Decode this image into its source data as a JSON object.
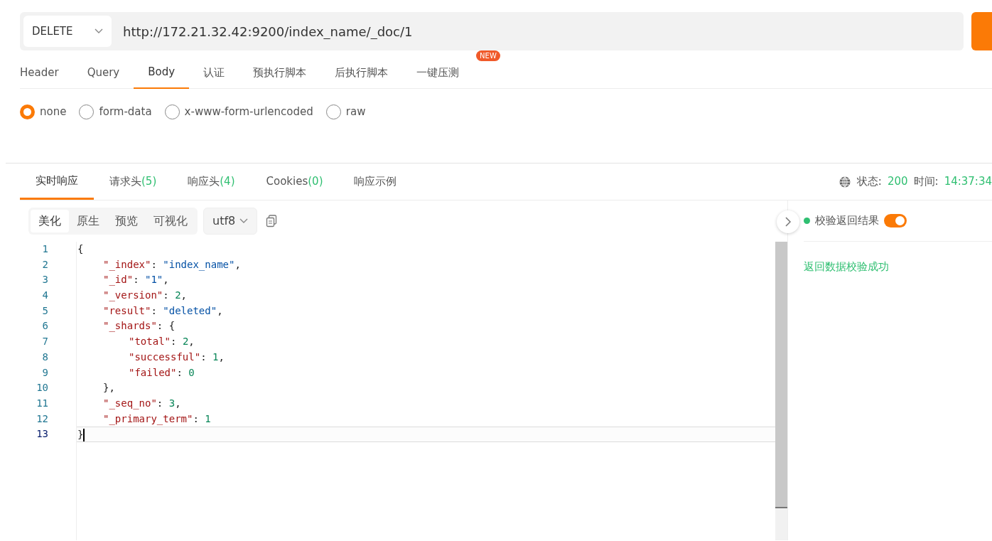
{
  "request": {
    "method": "DELETE",
    "url": "http://172.21.32.42:9200/index_name/_doc/1"
  },
  "request_tabs": [
    {
      "label": "Header",
      "selected": false
    },
    {
      "label": "Query",
      "selected": false
    },
    {
      "label": "Body",
      "selected": true
    },
    {
      "label": "认证",
      "selected": false
    },
    {
      "label": "预执行脚本",
      "selected": false
    },
    {
      "label": "后执行脚本",
      "selected": false
    },
    {
      "label": "一键压测",
      "selected": false,
      "badge": "NEW"
    }
  ],
  "body_types": [
    {
      "label": "none",
      "selected": true
    },
    {
      "label": "form-data",
      "selected": false
    },
    {
      "label": "x-www-form-urlencoded",
      "selected": false
    },
    {
      "label": "raw",
      "selected": false
    }
  ],
  "response_tabs": [
    {
      "label": "实时响应",
      "selected": true
    },
    {
      "label": "请求头",
      "count": "(5)",
      "selected": false
    },
    {
      "label": "响应头",
      "count": "(4)",
      "selected": false
    },
    {
      "label": "Cookies",
      "count": "(0)",
      "selected": false
    },
    {
      "label": "响应示例",
      "selected": false
    }
  ],
  "status": {
    "status_label": "状态:",
    "status_value": "200",
    "time_label": "时间:",
    "time_value": "14:37:34"
  },
  "view_modes": [
    {
      "label": "美化",
      "selected": true
    },
    {
      "label": "原生",
      "selected": false
    },
    {
      "label": "预览",
      "selected": false
    },
    {
      "label": "可视化",
      "selected": false
    }
  ],
  "encoding": "utf8",
  "code_lines": [
    {
      "number": "1",
      "tokens": [
        {
          "kind": "punct",
          "text": "{"
        }
      ],
      "current": false,
      "children": [
        {
          "number": "2",
          "tokens": [
            {
              "kind": "key",
              "text": "\"_index\""
            },
            {
              "kind": "punct",
              "text": ": "
            },
            {
              "kind": "string",
              "text": "\"index_name\""
            },
            {
              "kind": "punct",
              "text": ","
            }
          ],
          "current": false
        },
        {
          "number": "3",
          "tokens": [
            {
              "kind": "key",
              "text": "\"_id\""
            },
            {
              "kind": "punct",
              "text": ": "
            },
            {
              "kind": "string",
              "text": "\"1\""
            },
            {
              "kind": "punct",
              "text": ","
            }
          ],
          "current": false
        },
        {
          "number": "4",
          "tokens": [
            {
              "kind": "key",
              "text": "\"_version\""
            },
            {
              "kind": "punct",
              "text": ": "
            },
            {
              "kind": "number",
              "text": "2"
            },
            {
              "kind": "punct",
              "text": ","
            }
          ],
          "current": false
        },
        {
          "number": "5",
          "tokens": [
            {
              "kind": "key",
              "text": "\"result\""
            },
            {
              "kind": "punct",
              "text": ": "
            },
            {
              "kind": "string",
              "text": "\"deleted\""
            },
            {
              "kind": "punct",
              "text": ","
            }
          ],
          "current": false
        },
        {
          "number": "6",
          "tokens": [
            {
              "kind": "key",
              "text": "\"_shards\""
            },
            {
              "kind": "punct",
              "text": ": {"
            }
          ],
          "current": false,
          "children": [
            {
              "number": "7",
              "tokens": [
                {
                  "kind": "key",
                  "text": "\"total\""
                },
                {
                  "kind": "punct",
                  "text": ": "
                },
                {
                  "kind": "number",
                  "text": "2"
                },
                {
                  "kind": "punct",
                  "text": ","
                }
              ],
              "current": false
            },
            {
              "number": "8",
              "tokens": [
                {
                  "kind": "key",
                  "text": "\"successful\""
                },
                {
                  "kind": "punct",
                  "text": ": "
                },
                {
                  "kind": "number",
                  "text": "1"
                },
                {
                  "kind": "punct",
                  "text": ","
                }
              ],
              "current": false
            },
            {
              "number": "9",
              "tokens": [
                {
                  "kind": "key",
                  "text": "\"failed\""
                },
                {
                  "kind": "punct",
                  "text": ": "
                },
                {
                  "kind": "number",
                  "text": "0"
                }
              ],
              "current": false
            }
          ]
        },
        {
          "number": "10",
          "tokens": [
            {
              "kind": "punct",
              "text": "},"
            }
          ],
          "current": false
        },
        {
          "number": "11",
          "tokens": [
            {
              "kind": "key",
              "text": "\"_seq_no\""
            },
            {
              "kind": "punct",
              "text": ": "
            },
            {
              "kind": "number",
              "text": "3"
            },
            {
              "kind": "punct",
              "text": ","
            }
          ],
          "current": false
        },
        {
          "number": "12",
          "tokens": [
            {
              "kind": "key",
              "text": "\"_primary_term\""
            },
            {
              "kind": "punct",
              "text": ": "
            },
            {
              "kind": "number",
              "text": "1"
            }
          ],
          "current": false
        }
      ]
    },
    {
      "number": "13",
      "tokens": [
        {
          "kind": "punct",
          "text": "}"
        }
      ],
      "current": true
    }
  ],
  "assertion": {
    "label": "校验返回结果",
    "on": true,
    "result": "返回数据校验成功"
  }
}
